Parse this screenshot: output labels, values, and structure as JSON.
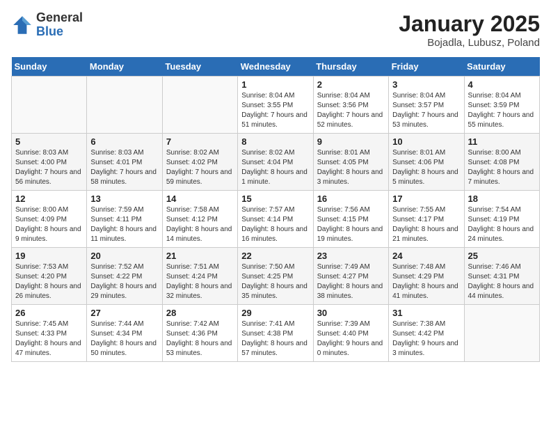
{
  "header": {
    "logo_general": "General",
    "logo_blue": "Blue",
    "title": "January 2025",
    "subtitle": "Bojadla, Lubusz, Poland"
  },
  "days_of_week": [
    "Sunday",
    "Monday",
    "Tuesday",
    "Wednesday",
    "Thursday",
    "Friday",
    "Saturday"
  ],
  "weeks": [
    [
      {
        "num": "",
        "info": ""
      },
      {
        "num": "",
        "info": ""
      },
      {
        "num": "",
        "info": ""
      },
      {
        "num": "1",
        "info": "Sunrise: 8:04 AM\nSunset: 3:55 PM\nDaylight: 7 hours and 51 minutes."
      },
      {
        "num": "2",
        "info": "Sunrise: 8:04 AM\nSunset: 3:56 PM\nDaylight: 7 hours and 52 minutes."
      },
      {
        "num": "3",
        "info": "Sunrise: 8:04 AM\nSunset: 3:57 PM\nDaylight: 7 hours and 53 minutes."
      },
      {
        "num": "4",
        "info": "Sunrise: 8:04 AM\nSunset: 3:59 PM\nDaylight: 7 hours and 55 minutes."
      }
    ],
    [
      {
        "num": "5",
        "info": "Sunrise: 8:03 AM\nSunset: 4:00 PM\nDaylight: 7 hours and 56 minutes."
      },
      {
        "num": "6",
        "info": "Sunrise: 8:03 AM\nSunset: 4:01 PM\nDaylight: 7 hours and 58 minutes."
      },
      {
        "num": "7",
        "info": "Sunrise: 8:02 AM\nSunset: 4:02 PM\nDaylight: 7 hours and 59 minutes."
      },
      {
        "num": "8",
        "info": "Sunrise: 8:02 AM\nSunset: 4:04 PM\nDaylight: 8 hours and 1 minute."
      },
      {
        "num": "9",
        "info": "Sunrise: 8:01 AM\nSunset: 4:05 PM\nDaylight: 8 hours and 3 minutes."
      },
      {
        "num": "10",
        "info": "Sunrise: 8:01 AM\nSunset: 4:06 PM\nDaylight: 8 hours and 5 minutes."
      },
      {
        "num": "11",
        "info": "Sunrise: 8:00 AM\nSunset: 4:08 PM\nDaylight: 8 hours and 7 minutes."
      }
    ],
    [
      {
        "num": "12",
        "info": "Sunrise: 8:00 AM\nSunset: 4:09 PM\nDaylight: 8 hours and 9 minutes."
      },
      {
        "num": "13",
        "info": "Sunrise: 7:59 AM\nSunset: 4:11 PM\nDaylight: 8 hours and 11 minutes."
      },
      {
        "num": "14",
        "info": "Sunrise: 7:58 AM\nSunset: 4:12 PM\nDaylight: 8 hours and 14 minutes."
      },
      {
        "num": "15",
        "info": "Sunrise: 7:57 AM\nSunset: 4:14 PM\nDaylight: 8 hours and 16 minutes."
      },
      {
        "num": "16",
        "info": "Sunrise: 7:56 AM\nSunset: 4:15 PM\nDaylight: 8 hours and 19 minutes."
      },
      {
        "num": "17",
        "info": "Sunrise: 7:55 AM\nSunset: 4:17 PM\nDaylight: 8 hours and 21 minutes."
      },
      {
        "num": "18",
        "info": "Sunrise: 7:54 AM\nSunset: 4:19 PM\nDaylight: 8 hours and 24 minutes."
      }
    ],
    [
      {
        "num": "19",
        "info": "Sunrise: 7:53 AM\nSunset: 4:20 PM\nDaylight: 8 hours and 26 minutes."
      },
      {
        "num": "20",
        "info": "Sunrise: 7:52 AM\nSunset: 4:22 PM\nDaylight: 8 hours and 29 minutes."
      },
      {
        "num": "21",
        "info": "Sunrise: 7:51 AM\nSunset: 4:24 PM\nDaylight: 8 hours and 32 minutes."
      },
      {
        "num": "22",
        "info": "Sunrise: 7:50 AM\nSunset: 4:25 PM\nDaylight: 8 hours and 35 minutes."
      },
      {
        "num": "23",
        "info": "Sunrise: 7:49 AM\nSunset: 4:27 PM\nDaylight: 8 hours and 38 minutes."
      },
      {
        "num": "24",
        "info": "Sunrise: 7:48 AM\nSunset: 4:29 PM\nDaylight: 8 hours and 41 minutes."
      },
      {
        "num": "25",
        "info": "Sunrise: 7:46 AM\nSunset: 4:31 PM\nDaylight: 8 hours and 44 minutes."
      }
    ],
    [
      {
        "num": "26",
        "info": "Sunrise: 7:45 AM\nSunset: 4:33 PM\nDaylight: 8 hours and 47 minutes."
      },
      {
        "num": "27",
        "info": "Sunrise: 7:44 AM\nSunset: 4:34 PM\nDaylight: 8 hours and 50 minutes."
      },
      {
        "num": "28",
        "info": "Sunrise: 7:42 AM\nSunset: 4:36 PM\nDaylight: 8 hours and 53 minutes."
      },
      {
        "num": "29",
        "info": "Sunrise: 7:41 AM\nSunset: 4:38 PM\nDaylight: 8 hours and 57 minutes."
      },
      {
        "num": "30",
        "info": "Sunrise: 7:39 AM\nSunset: 4:40 PM\nDaylight: 9 hours and 0 minutes."
      },
      {
        "num": "31",
        "info": "Sunrise: 7:38 AM\nSunset: 4:42 PM\nDaylight: 9 hours and 3 minutes."
      },
      {
        "num": "",
        "info": ""
      }
    ]
  ]
}
